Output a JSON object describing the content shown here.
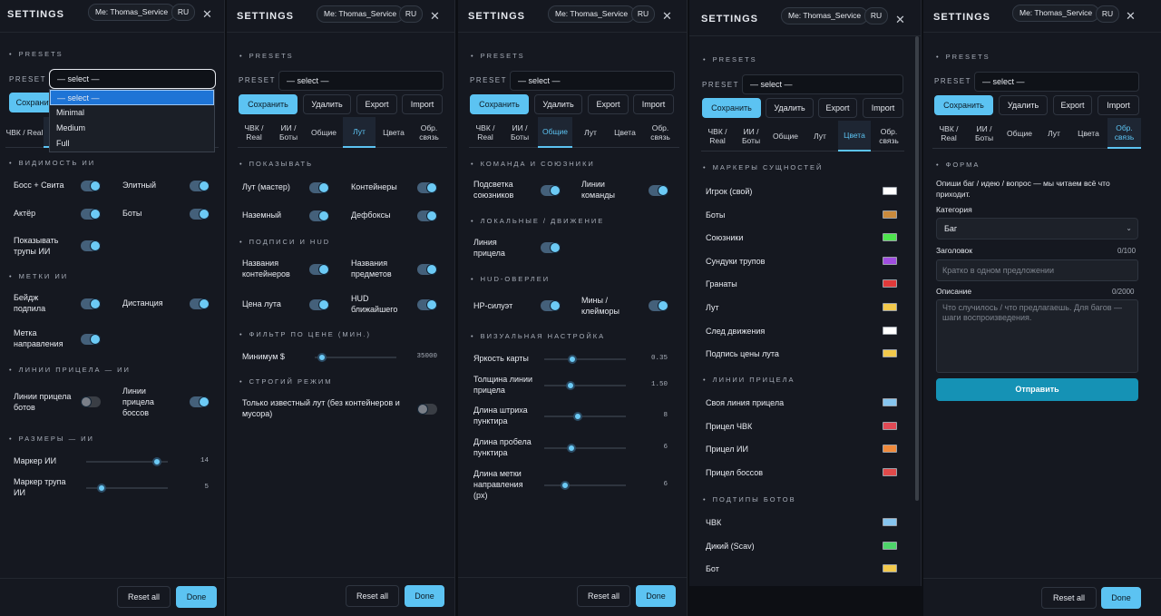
{
  "common": {
    "title": "SETTINGS",
    "me": "Me: Thomas_Service",
    "lang": "RU",
    "close": "✕",
    "presets_label": "PRESETS",
    "preset_label": "PRESET",
    "preset_value": "— select —",
    "buttons": {
      "save": "Сохранить",
      "delete": "Удалить",
      "export": "Export",
      "import": "Import"
    },
    "tabs": [
      "ЧВК / Real",
      "ИИ / Боты",
      "Общие",
      "Лут",
      "Цвета",
      "Обр. связь"
    ],
    "reset": "Reset all",
    "done": "Done",
    "accent": "#5cc3f2"
  },
  "p1": {
    "dropdown": [
      "— select —",
      "Minimal",
      "Medium",
      "Full"
    ],
    "tab_first": "ЧВК / Real",
    "sec_visibility": "ВИДИМОСТЬ ИИ",
    "boss": "Босс + Свита",
    "elite": "Элитный",
    "actor": "Актёр",
    "bots": "Боты",
    "corpses": "Показывать трупы ИИ",
    "sec_marks": "МЕТКИ ИИ",
    "badge": "Бейдж подпила",
    "distance": "Дистанция",
    "dir_mark": "Метка направления",
    "sec_sight": "ЛИНИИ ПРИЦЕЛА — ИИ",
    "bot_sight": "Линии прицела ботов",
    "boss_sight": "Линии прицела боссов",
    "sec_sizes": "РАЗМЕРЫ — ИИ",
    "ai_marker": "Маркер ИИ",
    "ai_marker_val": "14",
    "corpse_marker": "Маркер трупа ИИ",
    "corpse_marker_val": "5"
  },
  "p2": {
    "sec_show": "ПОКАЗЫВАТЬ",
    "loot_master": "Лут (мастер)",
    "containers": "Контейнеры",
    "ground": "Наземный",
    "stashes": "Дефбоксы",
    "sec_labels": "ПОДПИСИ И HUD",
    "cont_names": "Названия контейнеров",
    "item_names": "Названия предметов",
    "loot_price": "Цена лута",
    "hud_nearest": "HUD ближайшего",
    "sec_price": "ФИЛЬТР ПО ЦЕНЕ (МИН.)",
    "minimum": "Минимум $",
    "minimum_val": "35000",
    "sec_strict": "СТРОГИЙ РЕЖИМ",
    "strict_text": "Только известный лут (без контейнеров и мусора)"
  },
  "p3": {
    "sec_team": "КОМАНДА И СОЮЗНИКИ",
    "ally_hl": "Подсветка союзников",
    "team_lines": "Линии команды",
    "sec_local": "ЛОКАЛЬНЫЕ / ДВИЖЕНИЕ",
    "aim_line": "Линия прицела",
    "sec_hud": "HUD-ОВЕРЛЕИ",
    "hp": "HP-силуэт",
    "mines": "Мины / клейморы",
    "sec_visual": "ВИЗУАЛЬНАЯ НАСТРОЙКА",
    "brightness": "Яркость карты",
    "brightness_val": "0.35",
    "thickness": "Толщина линии прицела",
    "thickness_val": "1.50",
    "dash_len": "Длина штриха пунктира",
    "dash_len_val": "8",
    "gap_len": "Длина пробела пунктира",
    "gap_len_val": "6",
    "dir_len": "Длина метки направления (px)",
    "dir_len_val": "6"
  },
  "p4": {
    "sec_entities": "МАРКЕРЫ СУЩНОСТЕЙ",
    "entities": [
      {
        "label": "Игрок (свой)",
        "color": "#ffffff"
      },
      {
        "label": "Боты",
        "color": "#c98a3c"
      },
      {
        "label": "Союзники",
        "color": "#4ee44e"
      },
      {
        "label": "Сундуки трупов",
        "color": "#a04ee0"
      },
      {
        "label": "Гранаты",
        "color": "#e03a3a"
      },
      {
        "label": "Лут",
        "color": "#f2c94c"
      },
      {
        "label": "След движения",
        "color": "#ffffff"
      },
      {
        "label": "Подпись цены лута",
        "color": "#f2c94c"
      }
    ],
    "sec_sight": "ЛИНИИ ПРИЦЕЛА",
    "sights": [
      {
        "label": "Своя линия прицела",
        "color": "#86c5ef"
      },
      {
        "label": "Прицел ЧВК",
        "color": "#e04a55"
      },
      {
        "label": "Прицел ИИ",
        "color": "#f08a3c"
      },
      {
        "label": "Прицел боссов",
        "color": "#e04a4a"
      }
    ],
    "sec_subtypes": "ПОДТИПЫ БОТОВ",
    "subtypes": [
      {
        "label": "ЧВК",
        "color": "#86c5ef"
      },
      {
        "label": "Дикий (Scav)",
        "color": "#4ed46a"
      },
      {
        "label": "Бот",
        "color": "#f2c94c"
      }
    ]
  },
  "p5": {
    "sec_form": "ФОРМА",
    "intro": "Опиши баг / идею / вопрос — мы читаем всё что приходит.",
    "category_label": "Категория",
    "category_value": "Баг",
    "subject_label": "Заголовок",
    "subject_count": "0/100",
    "subject_placeholder": "Кратко в одном предложении",
    "desc_label": "Описание",
    "desc_count": "0/2000",
    "desc_placeholder": "Что случилось / что предлагаешь. Для багов — шаги воспроизведения.",
    "send": "Отправить"
  }
}
